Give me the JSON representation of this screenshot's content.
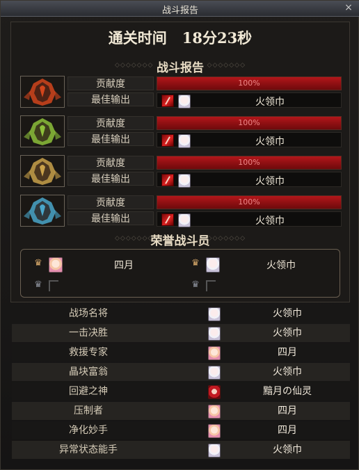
{
  "window": {
    "title": "战斗报告",
    "close_glyph": "×"
  },
  "clear_time": {
    "label": "通关时间",
    "value": "18分23秒"
  },
  "battle_report": {
    "heading": "战斗报告",
    "contribution_label": "贡献度",
    "best_output_label": "最佳输出",
    "raids": [
      {
        "boss_color": "#d2451c",
        "contribution_pct": 100,
        "contribution_text": "100%",
        "best_output_name": "火领巾"
      },
      {
        "boss_color": "#8dbf3a",
        "contribution_pct": 100,
        "contribution_text": "100%",
        "best_output_name": "火领巾"
      },
      {
        "boss_color": "#c9a14a",
        "contribution_pct": 100,
        "contribution_text": "100%",
        "best_output_name": "火领巾"
      },
      {
        "boss_color": "#4aa6c9",
        "contribution_pct": 100,
        "contribution_text": "100%",
        "best_output_name": "火领巾"
      }
    ]
  },
  "honor": {
    "heading": "荣誉战斗员",
    "slots": [
      {
        "name": "四月",
        "avatar": "pink",
        "filled": true
      },
      {
        "name": "火领巾",
        "avatar": "white",
        "filled": true
      },
      {
        "name": "",
        "filled": false
      },
      {
        "name": "",
        "filled": false
      }
    ]
  },
  "awards": [
    {
      "title": "战场名将",
      "name": "火领巾",
      "avatar": "white"
    },
    {
      "title": "一击决胜",
      "name": "火领巾",
      "avatar": "white"
    },
    {
      "title": "救援专家",
      "name": "四月",
      "avatar": "pink"
    },
    {
      "title": "晶块富翁",
      "name": "火领巾",
      "avatar": "white"
    },
    {
      "title": "回避之神",
      "name": "黯月の仙灵",
      "avatar": "red"
    },
    {
      "title": "压制者",
      "name": "四月",
      "avatar": "pink"
    },
    {
      "title": "净化妙手",
      "name": "四月",
      "avatar": "pink"
    },
    {
      "title": "异常状态能手",
      "name": "火领巾",
      "avatar": "white"
    }
  ],
  "colors": {
    "bar_fill": "#b3161a",
    "bar_bg": "#3a0a0a",
    "text_main": "#f0e8d8"
  }
}
